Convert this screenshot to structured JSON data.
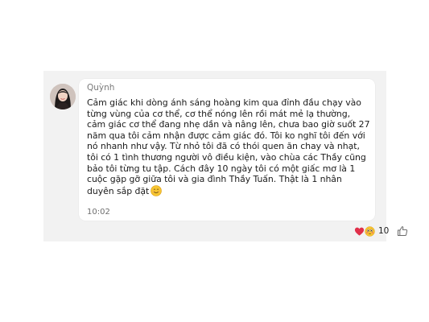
{
  "message": {
    "sender": "Quỳnh",
    "text": "Cảm giác khi dòng ánh sáng hoàng kim qua đỉnh đầu chạy vào từng vùng của cơ thể, cơ thể nóng lên rồi mát mẻ lạ thường, cảm giác cơ thể đang nhẹ dần và nâng lên, chưa bao giờ suốt 27 năm qua tôi cảm nhận được cảm giác đó. Tôi ko nghĩ tôi đến với nó nhanh như vậy. Từ nhỏ tôi đã có thói quen ăn chay và nhạt, tôi có 1 tình thương người vô điều kiện, vào chùa các Thầy cũng bảo tôi từng tu tập. Cách đây 10 ngày tôi có một giấc mơ là 1 cuộc gặp gỡ giữa tôi và gia đình Thầy Tuấn. Thật là 1 nhân duyên sắp đặt",
    "time": "10:02",
    "trailing_emoji": "smiling-face"
  },
  "reactions": {
    "icons": [
      "heart",
      "flushed-face"
    ],
    "count": "10"
  },
  "colors": {
    "background": "#f2f2f2",
    "bubble": "#ffffff",
    "heart": "#e0304a",
    "emoji": "#f7c531"
  }
}
